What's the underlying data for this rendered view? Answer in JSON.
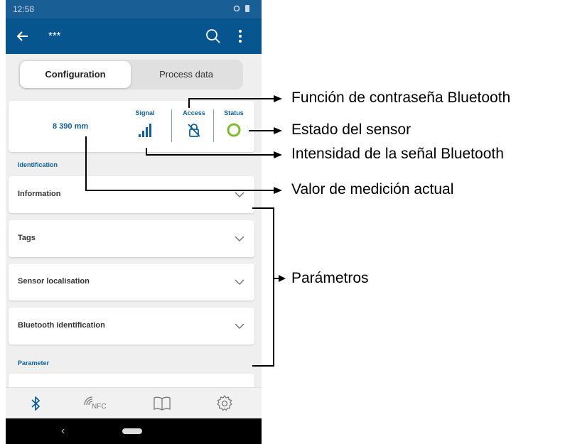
{
  "status_bar": {
    "time": "12:58"
  },
  "app_bar": {
    "title": "***",
    "back_icon": "arrow-left-icon",
    "search_icon": "search-icon",
    "more_icon": "more-vertical-icon"
  },
  "tabs": {
    "active": "Configuration",
    "inactive": "Process data"
  },
  "measurement": {
    "value": "8 390 mm",
    "signal_label": "Signal",
    "access_label": "Access",
    "status_label": "Status",
    "signal_icon": "signal-bars-icon",
    "access_icon": "lock-crossed-icon",
    "status_icon": "status-ring-icon"
  },
  "sections": {
    "identification_title": "Identification",
    "parameter_title": "Parameter",
    "items": [
      {
        "label": "Information"
      },
      {
        "label": "Tags"
      },
      {
        "label": "Sensor localisation"
      },
      {
        "label": "Bluetooth identification"
      }
    ]
  },
  "bottom_nav": {
    "items": [
      "bluetooth-icon",
      "nfc-icon",
      "book-icon",
      "settings-gear-icon"
    ],
    "nfc_text": "NFC"
  },
  "annotations": {
    "password_function": "Función de contraseña Bluetooth",
    "sensor_status": "Estado del sensor",
    "signal_strength": "Intensidad de la señal Bluetooth",
    "current_value": "Valor de medición actual",
    "parameters": "Parámetros"
  },
  "colors": {
    "app_bar": "#07558f",
    "status_bar": "#1a5e96",
    "accent_blue": "#0e5f9c",
    "status_green": "#7cbd2c"
  }
}
